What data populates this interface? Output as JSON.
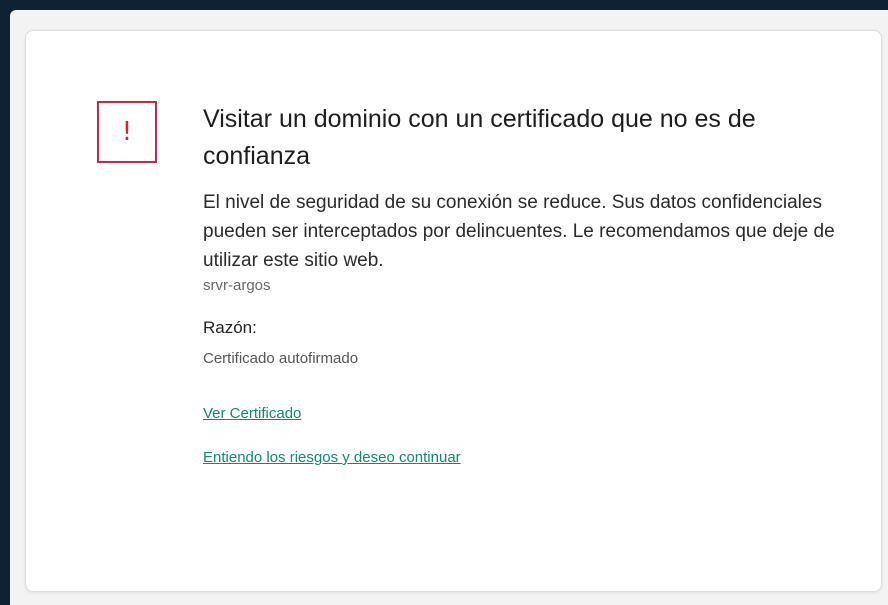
{
  "warning": {
    "icon": "exclamation-icon",
    "icon_glyph": "!",
    "accent_color": "#d8213b"
  },
  "title": "Visitar un dominio con un certificado que no es de confianza",
  "description": "El nivel de seguridad de su conexión se reduce. Sus datos confidenciales pueden ser interceptados por delincuentes. Le recomendamos que deje de utilizar este sitio web.",
  "host": "srvr-argos",
  "reason": {
    "label": "Razón:",
    "value": "Certificado autofirmado"
  },
  "links": {
    "view_certificate": "Ver Certificado",
    "continue": "Entiendo los riesgos y deseo continuar",
    "link_color": "#0f8a6f"
  }
}
